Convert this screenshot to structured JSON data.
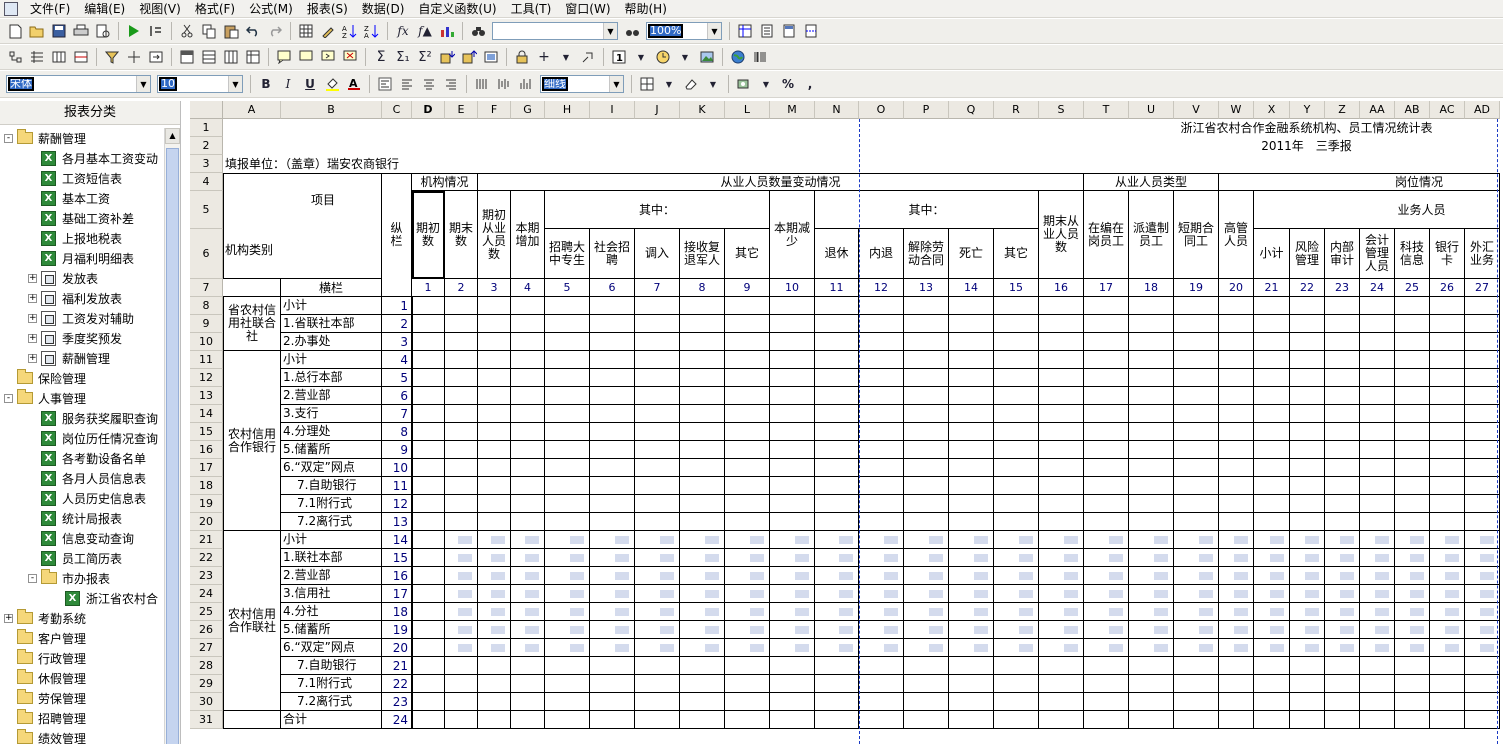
{
  "app": {
    "menu": [
      "文件(F)",
      "编辑(E)",
      "视图(V)",
      "格式(F)",
      "公式(M)",
      "报表(S)",
      "数据(D)",
      "自定义函数(U)",
      "工具(T)",
      "窗口(W)",
      "帮助(H)"
    ]
  },
  "toolbar": {
    "zoom": "100%",
    "font_name": "宋体",
    "font_size": "10",
    "line_style": "细线",
    "percent": "%",
    "comma": ","
  },
  "left_panel": {
    "title": "报表分类",
    "items": [
      {
        "label": "薪酬管理",
        "icon": "folder-icon",
        "lvl": 0,
        "exp": "-"
      },
      {
        "label": "各月基本工资变动",
        "icon": "excel-icon",
        "lvl": 1
      },
      {
        "label": "工资短信表",
        "icon": "excel-icon",
        "lvl": 1
      },
      {
        "label": "基本工资",
        "icon": "excel-icon",
        "lvl": 1
      },
      {
        "label": "基础工资补差",
        "icon": "excel-icon",
        "lvl": 1
      },
      {
        "label": "上报地税表",
        "icon": "excel-icon",
        "lvl": 1
      },
      {
        "label": "月福利明细表",
        "icon": "excel-icon",
        "lvl": 1
      },
      {
        "label": "发放表",
        "icon": "report-icon",
        "lvl": 1,
        "exp": "+"
      },
      {
        "label": "福利发放表",
        "icon": "report-icon",
        "lvl": 1,
        "exp": "+"
      },
      {
        "label": "工资发对辅助",
        "icon": "report-icon",
        "lvl": 1,
        "exp": "+"
      },
      {
        "label": "季度奖预发",
        "icon": "report-icon",
        "lvl": 1,
        "exp": "+"
      },
      {
        "label": "薪酬管理",
        "icon": "report-icon",
        "lvl": 1,
        "exp": "+"
      },
      {
        "label": "保险管理",
        "icon": "folder-icon",
        "lvl": 0
      },
      {
        "label": "人事管理",
        "icon": "folder-icon",
        "lvl": 0,
        "exp": "-"
      },
      {
        "label": "服务获奖履职查询",
        "icon": "excel-icon",
        "lvl": 1
      },
      {
        "label": "岗位历任情况查询",
        "icon": "excel-icon",
        "lvl": 1
      },
      {
        "label": "各考勤设备名单",
        "icon": "excel-icon",
        "lvl": 1
      },
      {
        "label": "各月人员信息表",
        "icon": "excel-icon",
        "lvl": 1
      },
      {
        "label": "人员历史信息表",
        "icon": "excel-icon",
        "lvl": 1
      },
      {
        "label": "统计局报表",
        "icon": "excel-icon",
        "lvl": 1
      },
      {
        "label": "信息变动查询",
        "icon": "excel-icon",
        "lvl": 1
      },
      {
        "label": "员工简历表",
        "icon": "excel-icon",
        "lvl": 1
      },
      {
        "label": "市办报表",
        "icon": "folder-icon",
        "lvl": 1,
        "exp": "-"
      },
      {
        "label": "浙江省农村合",
        "icon": "excel-icon",
        "lvl": 2
      },
      {
        "label": "考勤系统",
        "icon": "folder-icon",
        "lvl": 0,
        "exp": "+"
      },
      {
        "label": "客户管理",
        "icon": "folder-icon",
        "lvl": 0
      },
      {
        "label": "行政管理",
        "icon": "folder-icon",
        "lvl": 0
      },
      {
        "label": "休假管理",
        "icon": "folder-icon",
        "lvl": 0
      },
      {
        "label": "劳保管理",
        "icon": "folder-icon",
        "lvl": 0
      },
      {
        "label": "招聘管理",
        "icon": "folder-icon",
        "lvl": 0
      },
      {
        "label": "绩效管理",
        "icon": "folder-icon",
        "lvl": 0
      }
    ]
  },
  "sheet": {
    "columns": [
      "A",
      "B",
      "C",
      "D",
      "E",
      "F",
      "G",
      "H",
      "I",
      "J",
      "K",
      "L",
      "M",
      "N",
      "O",
      "P",
      "Q",
      "R",
      "S",
      "T",
      "U",
      "V",
      "W",
      "X",
      "Y",
      "Z",
      "AA",
      "AB",
      "AC",
      "AD"
    ],
    "rows": [
      "1",
      "2",
      "3",
      "4",
      "5",
      "6",
      "7",
      "8",
      "9",
      "10",
      "11",
      "12",
      "13",
      "14",
      "15",
      "16",
      "17",
      "18",
      "19",
      "20",
      "21",
      "22",
      "23",
      "24",
      "25",
      "26",
      "27",
      "28",
      "29",
      "30",
      "31"
    ],
    "title": "浙江省农村合作金融系统机构、员工情况统计表",
    "period": "2011年　三季报",
    "filler": "填报单位：（盖章）瑞安农商银行",
    "hdr": {
      "xiangmu": "项目",
      "jigoulei": "机构类别",
      "zonglan": "纵栏",
      "henglan": "横栏",
      "jigouqk": "机构情况",
      "congye_bd": "从业人员数量变动情况",
      "congye_lx": "从业人员类型",
      "gangwei": "岗位情况",
      "qizhong1": "其中：",
      "qizhong2": "其中：",
      "yewu": "业务人员",
      "qichu": "期初数",
      "qimo": "期末数",
      "qichu_cy": "期初从业人员数",
      "benqi_zj": "本期增加",
      "zhaopin_dz": "招聘大中专生",
      "shehui_zp": "社会招聘",
      "diaoru": "调入",
      "jieshou_fu": "接收复退军人",
      "qita1": "其它",
      "benqi_js": "本期减少",
      "tuixiu": "退休",
      "neitui": "内退",
      "jiechu": "解除劳动合同",
      "siwang": "死亡",
      "qita2": "其它",
      "qimo_cy": "期末从业人员数",
      "zaibian": "在编在岗员工",
      "paiqian": "派遣制员工",
      "duanqi": "短期合同工",
      "gaoguan": "高管人员",
      "xiaoji": "小计",
      "fengxian": "风险管理",
      "neibu": "内部审计",
      "kuaiji": "会计管理人员",
      "keji": "科技信息",
      "yinhangka": "银行卡",
      "waihui": "外汇业务"
    },
    "colnums": [
      "1",
      "2",
      "3",
      "4",
      "5",
      "6",
      "7",
      "8",
      "9",
      "10",
      "11",
      "12",
      "13",
      "14",
      "15",
      "16",
      "17",
      "18",
      "19",
      "20",
      "21",
      "22",
      "23",
      "24",
      "25",
      "26",
      "27"
    ],
    "groups": [
      "省农村信用社联合社",
      "农村信用合作银行",
      "农村信用合作联社"
    ],
    "items": [
      {
        "label": "小计",
        "n": "1"
      },
      {
        "label": "1.省联社本部",
        "n": "2"
      },
      {
        "label": "2.办事处",
        "n": "3"
      },
      {
        "label": "小计",
        "n": "4"
      },
      {
        "label": "1.总行本部",
        "n": "5"
      },
      {
        "label": "2.营业部",
        "n": "6"
      },
      {
        "label": "3.支行",
        "n": "7"
      },
      {
        "label": "4.分理处",
        "n": "8"
      },
      {
        "label": "5.储蓄所",
        "n": "9"
      },
      {
        "label": "6.“双定”网点",
        "n": "10"
      },
      {
        "label": "7.自助银行",
        "n": "11"
      },
      {
        "label": "7.1附行式",
        "n": "12"
      },
      {
        "label": "7.2离行式",
        "n": "13"
      },
      {
        "label": "小计",
        "n": "14"
      },
      {
        "label": "1.联社本部",
        "n": "15"
      },
      {
        "label": "2.营业部",
        "n": "16"
      },
      {
        "label": "3.信用社",
        "n": "17"
      },
      {
        "label": "4.分社",
        "n": "18"
      },
      {
        "label": "5.储蓄所",
        "n": "19"
      },
      {
        "label": "6.“双定”网点",
        "n": "20"
      },
      {
        "label": "7.自助银行",
        "n": "21"
      },
      {
        "label": "7.1附行式",
        "n": "22"
      },
      {
        "label": "7.2离行式",
        "n": "23"
      },
      {
        "label": "合计",
        "n": "24"
      }
    ]
  }
}
